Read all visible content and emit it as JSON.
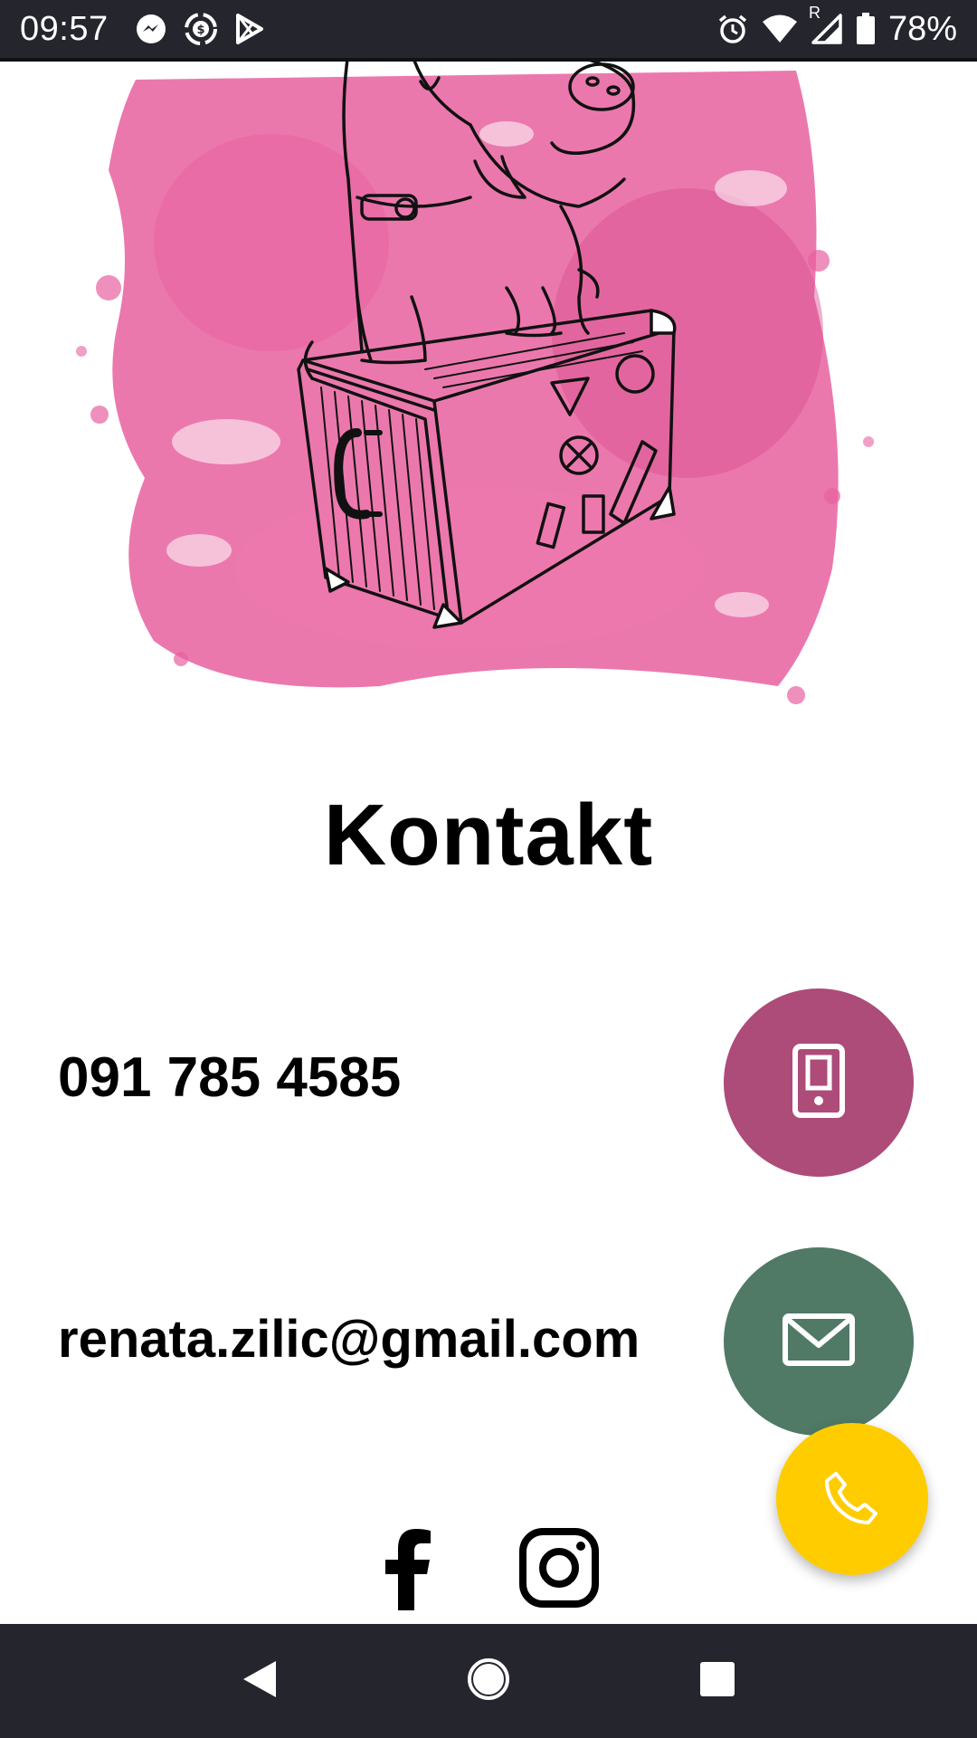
{
  "status_bar": {
    "time": "09:57",
    "battery": "78%",
    "notification_icons": [
      "messenger-icon",
      "dollar-sync-icon",
      "play-store-icon"
    ],
    "system_icons": [
      "alarm-icon",
      "wifi-icon",
      "signal-roaming-icon",
      "battery-icon"
    ],
    "roaming_label": "R"
  },
  "hero": {
    "icon": "pig-on-suitcase-illustration",
    "accent_color": "#e8609f"
  },
  "contact": {
    "title": "Kontakt",
    "phone": "091 785 4585",
    "email": "renata.zilic@gmail.com",
    "phone_button_icon": "mobile-phone-icon",
    "phone_button_color": "#ad4b79",
    "email_button_icon": "envelope-icon",
    "email_button_color": "#507a66"
  },
  "fab": {
    "icon": "phone-handset-icon",
    "color": "#ffcc00"
  },
  "social": [
    "facebook-icon",
    "instagram-icon"
  ],
  "nav_bar": [
    "back-icon",
    "home-icon",
    "recents-icon"
  ]
}
